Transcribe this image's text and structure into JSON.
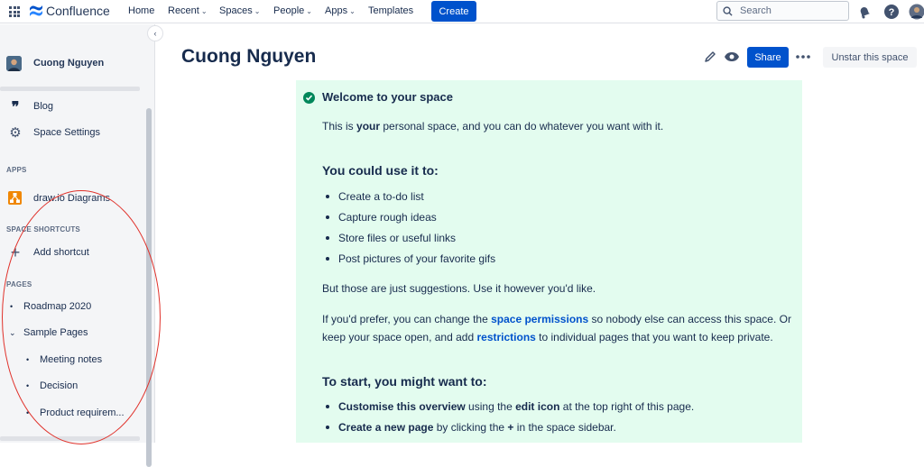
{
  "topnav": {
    "brand": "Confluence",
    "items": [
      "Home",
      "Recent",
      "Spaces",
      "People",
      "Apps",
      "Templates"
    ],
    "create_label": "Create",
    "search_placeholder": "Search"
  },
  "sidebar": {
    "space_name": "Cuong Nguyen",
    "items": {
      "blog": "Blog",
      "settings": "Space Settings"
    },
    "apps_section": "APPS",
    "apps": [
      "draw.io Diagrams"
    ],
    "shortcuts_section": "SPACE SHORTCUTS",
    "add_shortcut": "Add shortcut",
    "pages_section": "PAGES",
    "pages": {
      "roadmap": "Roadmap 2020",
      "sample": "Sample Pages",
      "children": [
        "Meeting notes",
        "Decision",
        "Product requirem..."
      ]
    }
  },
  "header": {
    "title": "Cuong Nguyen",
    "share_label": "Share",
    "unstar_label": "Unstar this space"
  },
  "panel": {
    "heading": "Welcome to your space",
    "intro_a": "This is ",
    "intro_b": "your",
    "intro_c": " personal space, and you can do whatever you want with it.",
    "use_heading": "You could use it to:",
    "uses": [
      "Create a to-do list",
      "Capture rough ideas",
      "Store files or useful links",
      "Post pictures of your favorite gifs"
    ],
    "suggestions": "But those are just suggestions. Use it however you'd like.",
    "pref_a": "If you'd prefer, you can change the ",
    "pref_link1": "space permissions",
    "pref_b": " so nobody else can access this space. Or",
    "pref_c": "keep your space open, and add ",
    "pref_link2": "restrictions",
    "pref_d": " to individual pages that you want to keep private.",
    "start_heading": "To start, you might want to:",
    "start1_a": "Customise this overview",
    "start1_b": " using the ",
    "start1_c": "edit icon",
    "start1_d": " at the top right of this page.",
    "start2_a": "Create a new page",
    "start2_b": " by clicking the ",
    "start2_c": "+",
    "start2_d": " in the space sidebar."
  },
  "colors": {
    "primary": "#0052cc",
    "panel_bg": "#e3fcef",
    "success": "#00875a",
    "annotation": "#e0312a"
  }
}
